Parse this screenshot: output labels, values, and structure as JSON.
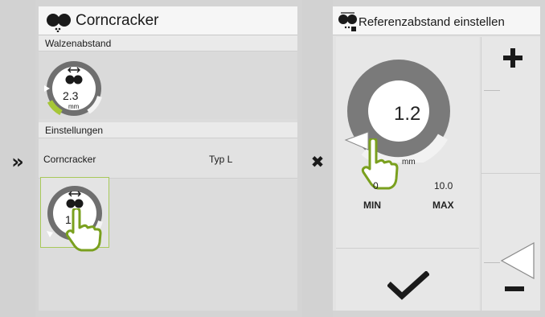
{
  "main": {
    "title": "Corncracker",
    "section_gap": "Walzenabstand",
    "gap_value": "2.3",
    "gap_unit": "mm",
    "section_settings": "Einstellungen",
    "setting_name": "Corncracker",
    "setting_value": "Typ L",
    "tile_value_partial": "1"
  },
  "dialog": {
    "title": "Referenzabstand einstellen",
    "value": "1.2",
    "unit": "mm",
    "min_value": "0",
    "max_value": "10.0",
    "min_label": "MIN",
    "max_label": "MAX"
  },
  "icons": {
    "expand": "double-chevron-right-icon",
    "close": "close-icon",
    "confirm": "checkmark-icon",
    "plus": "plus-icon",
    "minus": "minus-icon",
    "pointer": "hand-pointer-icon"
  },
  "colors": {
    "accent_green": "#7aa01e",
    "dial_gray": "#7a7a7a"
  }
}
